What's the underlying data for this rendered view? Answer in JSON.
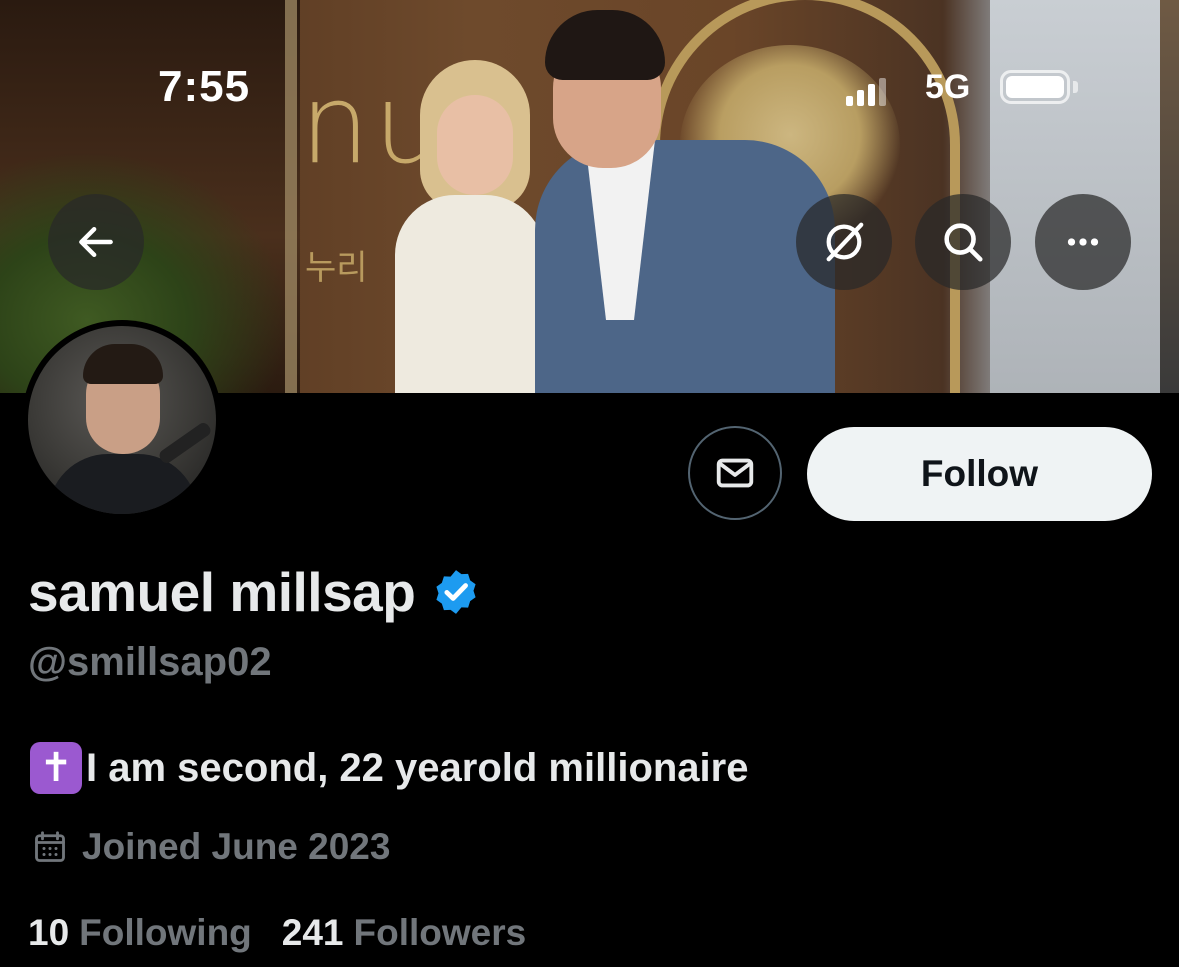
{
  "status_bar": {
    "time": "7:55",
    "network": "5G"
  },
  "banner": {
    "sign_text": "nu",
    "sign_small_text": "누리"
  },
  "header_actions": {
    "back_icon": "back-arrow-icon",
    "grok_icon": "grok-icon",
    "search_icon": "search-icon",
    "more_icon": "more-horizontal-icon"
  },
  "actions": {
    "message_icon": "envelope-icon",
    "follow_label": "Follow"
  },
  "profile": {
    "display_name": "samuel millsap",
    "verified": true,
    "handle": "@smillsap02",
    "bio_emoji": "✝",
    "bio": "I am second, 22 yearold millionaire",
    "joined": "Joined June 2023",
    "following_count": "10",
    "following_label": "Following",
    "followers_count": "241",
    "followers_label": "Followers"
  },
  "colors": {
    "background": "#000000",
    "text_primary": "#e7e9ea",
    "text_secondary": "#71767b",
    "verified_blue": "#1d9bf0",
    "follow_button_bg": "#eff3f4"
  }
}
